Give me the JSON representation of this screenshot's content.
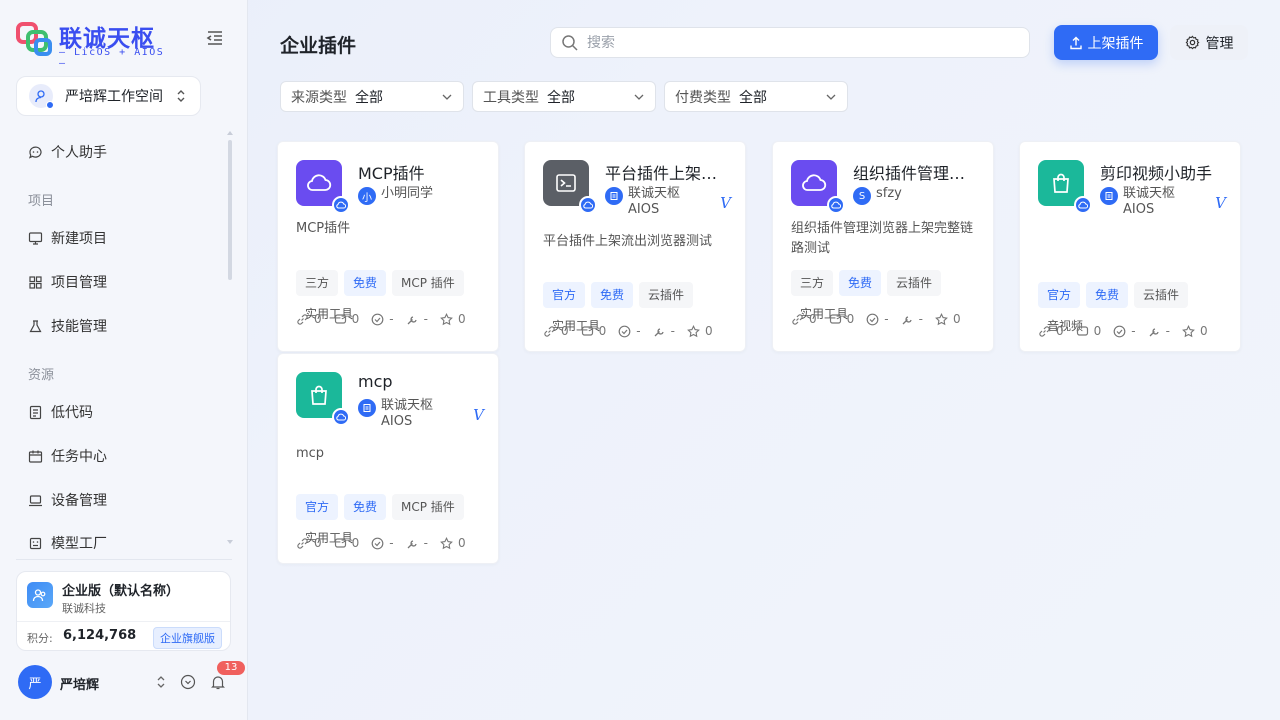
{
  "brand": {
    "name": "联诚天枢",
    "sub": "— LicOS + AIOS —"
  },
  "workspace": {
    "name": "严培辉工作空间"
  },
  "nav": {
    "assistant": "个人助手",
    "section_project": "项目",
    "new_project": "新建项目",
    "project_mgmt": "项目管理",
    "skill_mgmt": "技能管理",
    "section_resource": "资源",
    "lowcode": "低代码",
    "task_center": "任务中心",
    "device_mgmt": "设备管理",
    "model_factory": "模型工厂"
  },
  "enterprise": {
    "name": "企业版（默认名称）",
    "company": "联诚科技",
    "points_label": "积分:",
    "points": "6,124,768",
    "badge": "企业旗舰版"
  },
  "user": {
    "avatar": "严",
    "name": "严培辉",
    "notifications": "13"
  },
  "header": {
    "title": "企业插件",
    "search_placeholder": "搜索",
    "publish_label": "上架插件",
    "manage_label": "管理"
  },
  "filters": [
    {
      "label": "来源类型",
      "value": "全部"
    },
    {
      "label": "工具类型",
      "value": "全部"
    },
    {
      "label": "付费类型",
      "value": "全部"
    }
  ],
  "cards": [
    {
      "title": "MCP插件",
      "author": "小明同学",
      "author_avatar": "小",
      "verified": false,
      "desc": "MCP插件",
      "tags": [
        "三方",
        "免费",
        "MCP 插件",
        "实用工具"
      ],
      "stats": {
        "links": "0",
        "chats": "0",
        "checks": "-",
        "tools": "-",
        "stars": "0"
      },
      "icon": "cloud-icon",
      "icon_color": "#6a4cf0"
    },
    {
      "title": "平台插件上架流出浏览器测试",
      "author": "联诚天枢 AIOS",
      "author_avatar": "",
      "verified": true,
      "verify_mark": "V",
      "desc": "平台插件上架流出浏览器测试",
      "tags": [
        "官方",
        "免费",
        "云插件",
        "实用工具"
      ],
      "stats": {
        "links": "0",
        "chats": "0",
        "checks": "-",
        "tools": "-",
        "stars": "0"
      },
      "icon": "terminal-icon",
      "icon_color": "#5b5f66"
    },
    {
      "title": "组织插件管理浏览器上架完整链路测试",
      "author": "sfzy",
      "author_avatar": "S",
      "verified": false,
      "desc": "组织插件管理浏览器上架完整链路测试",
      "tags": [
        "三方",
        "免费",
        "云插件",
        "实用工具"
      ],
      "stats": {
        "links": "0",
        "chats": "0",
        "checks": "-",
        "tools": "-",
        "stars": "0"
      },
      "icon": "cloud-icon",
      "icon_color": "#6a4cf0"
    },
    {
      "title": "剪印视频小助手",
      "author": "联诚天枢 AIOS",
      "author_avatar": "",
      "verified": true,
      "verify_mark": "V",
      "desc": "",
      "tags": [
        "官方",
        "免费",
        "云插件",
        "音视频"
      ],
      "stats": {
        "links": "0",
        "chats": "0",
        "checks": "-",
        "tools": "-",
        "stars": "0"
      },
      "icon": "shopping-bag-icon",
      "icon_color": "#1bb89a"
    },
    {
      "title": "mcp",
      "author": "联诚天枢 AIOS",
      "author_avatar": "",
      "verified": true,
      "verify_mark": "V",
      "desc": "mcp",
      "tags": [
        "官方",
        "免费",
        "MCP 插件",
        "实用工具"
      ],
      "stats": {
        "links": "0",
        "chats": "0",
        "checks": "-",
        "tools": "-",
        "stars": "0"
      },
      "icon": "shopping-bag-icon",
      "icon_color": "#1bb89a"
    }
  ]
}
